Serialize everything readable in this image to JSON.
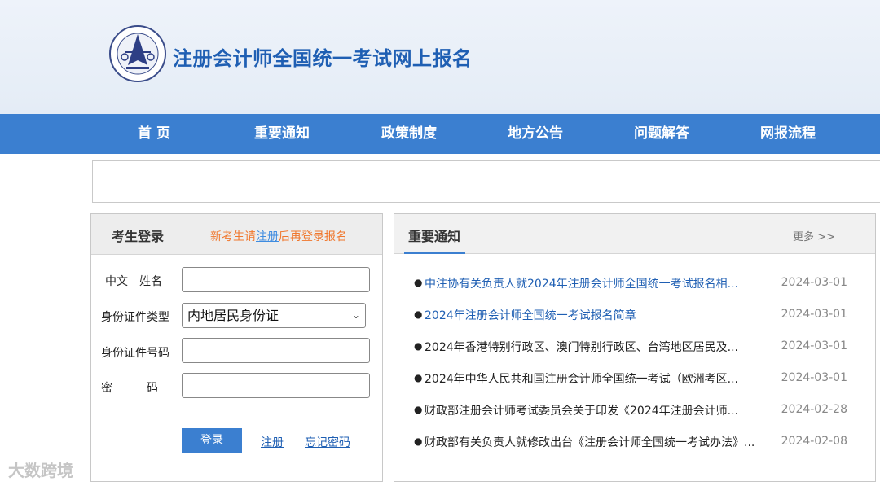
{
  "header": {
    "site_title": "注册会计师全国统一考试网上报名"
  },
  "nav": {
    "items": [
      "首 页",
      "重要通知",
      "政策制度",
      "地方公告",
      "问题解答",
      "网报流程"
    ]
  },
  "login": {
    "title": "考生登录",
    "hint_prefix": "新考生请",
    "hint_link": "注册",
    "hint_suffix": "后再登录报名",
    "fields": {
      "name_label": "中文　姓名",
      "id_type_label": "身份证件类型",
      "id_type_value": "内地居民身份证",
      "id_number_label": "身份证件号码",
      "password_label": "密　　　码"
    },
    "login_button": "登录",
    "register_link": "注册",
    "forgot_link": "忘记密码"
  },
  "notices": {
    "title": "重要通知",
    "more": "更多 >>",
    "items": [
      {
        "text": "中注协有关负责人就2024年注册会计师全国统一考试报名相...",
        "date": "2024-03-01"
      },
      {
        "text": "2024年注册会计师全国统一考试报名简章",
        "date": "2024-03-01"
      },
      {
        "text": "2024年香港特别行政区、澳门特别行政区、台湾地区居民及...",
        "date": "2024-03-01"
      },
      {
        "text": "2024年中华人民共和国注册会计师全国统一考试（欧洲考区...",
        "date": "2024-03-01"
      },
      {
        "text": "财政部注册会计师考试委员会关于印发《2024年注册会计师...",
        "date": "2024-02-28"
      },
      {
        "text": "财政部有关负责人就修改出台《注册会计师全国统一考试办法》...",
        "date": "2024-02-08"
      }
    ]
  },
  "watermark": "大数跨境",
  "colors": {
    "nav_bg": "#3b7fd0",
    "title_blue": "#1f5fb3",
    "hint_orange": "#f0772d"
  }
}
